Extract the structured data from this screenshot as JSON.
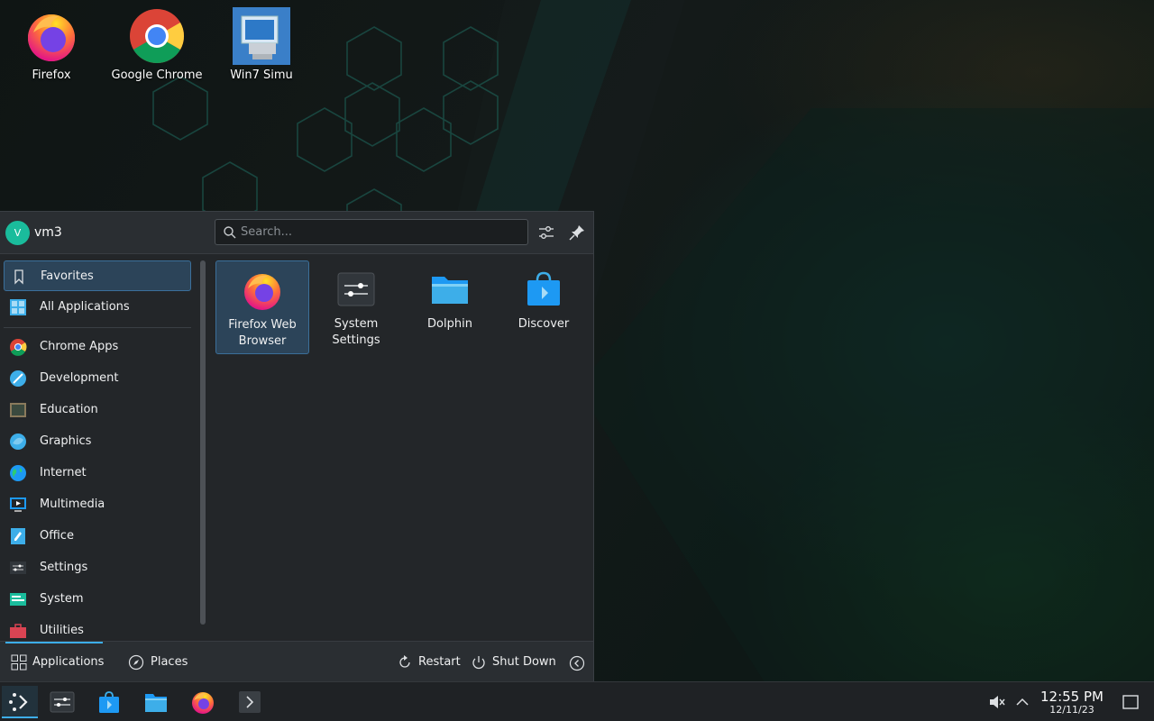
{
  "desktop": {
    "icons": [
      {
        "label": "Firefox",
        "icon": "firefox-icon"
      },
      {
        "label": "Google Chrome",
        "icon": "chrome-icon"
      },
      {
        "label": "Win7 Simu",
        "icon": "win7-simu-icon"
      }
    ]
  },
  "launcher": {
    "user": {
      "initial": "V",
      "name": "vm3"
    },
    "search": {
      "placeholder": "Search..."
    },
    "header_buttons": [
      "configure-icon",
      "pin-icon"
    ],
    "sidebar": {
      "items": [
        {
          "label": "Favorites",
          "icon": "bookmark-icon",
          "active": true
        },
        {
          "label": "All Applications",
          "icon": "grid-icon"
        },
        {
          "label": "Chrome Apps",
          "icon": "chrome-icon"
        },
        {
          "label": "Development",
          "icon": "development-icon"
        },
        {
          "label": "Education",
          "icon": "education-icon"
        },
        {
          "label": "Graphics",
          "icon": "graphics-icon"
        },
        {
          "label": "Internet",
          "icon": "internet-icon"
        },
        {
          "label": "Multimedia",
          "icon": "multimedia-icon"
        },
        {
          "label": "Office",
          "icon": "office-icon"
        },
        {
          "label": "Settings",
          "icon": "settings-icon"
        },
        {
          "label": "System",
          "icon": "system-icon"
        },
        {
          "label": "Utilities",
          "icon": "utilities-icon"
        }
      ]
    },
    "favorites": [
      {
        "label": "Firefox Web Browser",
        "icon": "firefox-icon",
        "active": true
      },
      {
        "label": "System Settings",
        "icon": "system-settings-icon"
      },
      {
        "label": "Dolphin",
        "icon": "folder-icon"
      },
      {
        "label": "Discover",
        "icon": "discover-icon"
      }
    ],
    "footer": {
      "applications": "Applications",
      "places": "Places",
      "restart": "Restart",
      "shutdown": "Shut Down"
    }
  },
  "taskbar": {
    "tasks": [
      "application-launcher-icon",
      "system-settings-icon",
      "discover-icon",
      "dolphin-icon",
      "firefox-icon",
      "expand-icon"
    ],
    "tray": [
      "volume-muted-icon",
      "show-hidden-icons-icon"
    ],
    "clock": {
      "time": "12:55 PM",
      "date": "12/11/23"
    }
  },
  "colors": {
    "accent": "#3daee9",
    "panel": "#232629",
    "selection": "#2c4459"
  }
}
